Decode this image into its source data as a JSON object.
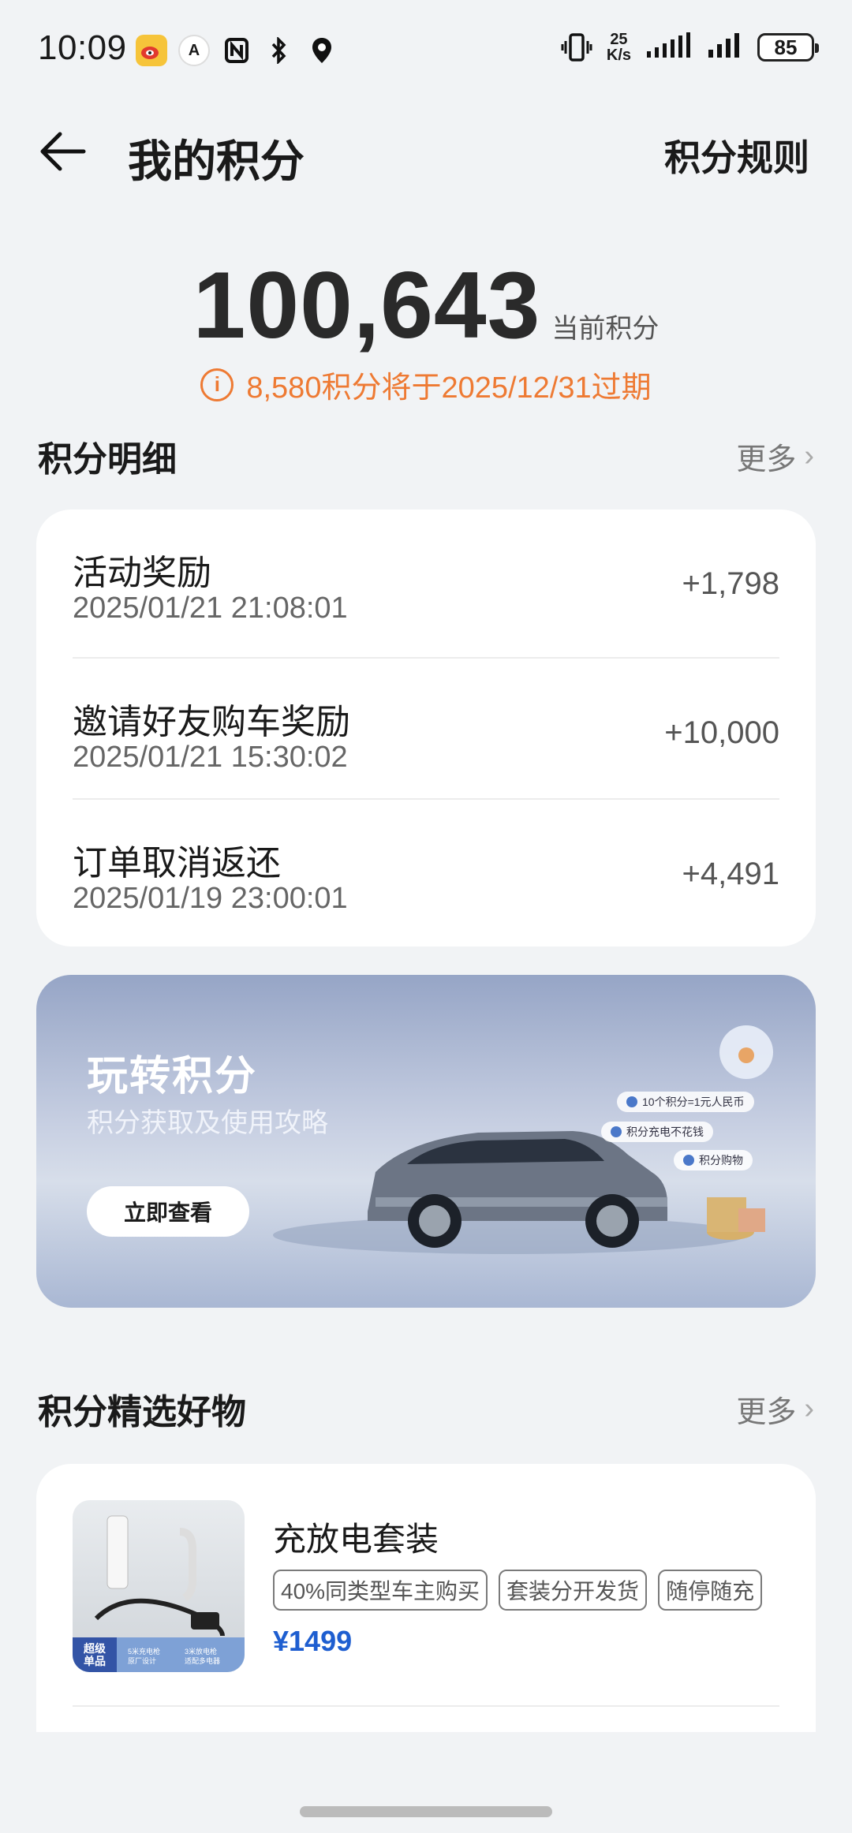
{
  "status_bar": {
    "time": "10:09",
    "net_speed_top": "25",
    "net_speed_bottom": "K/s",
    "battery": "85",
    "icons": [
      "weibo-icon",
      "app-a-icon",
      "nfc-icon",
      "bluetooth-icon",
      "location-icon",
      "vibrate-icon",
      "signal-icon",
      "signal-icon",
      "battery-icon"
    ]
  },
  "header": {
    "title": "我的积分",
    "rules_link": "积分规则"
  },
  "points": {
    "value": "100,643",
    "label": "当前积分",
    "expire_notice": "8,580积分将于2025/12/31过期",
    "info_glyph": "i",
    "accent_color": "#ee7a33"
  },
  "details_section": {
    "title": "积分明细",
    "more": "更多",
    "records": [
      {
        "title": "活动奖励",
        "time": "2025/01/21 21:08:01",
        "amount": "+1,798"
      },
      {
        "title": "邀请好友购车奖励",
        "time": "2025/01/21 15:30:02",
        "amount": "+10,000"
      },
      {
        "title": "订单取消返还",
        "time": "2025/01/19 23:00:01",
        "amount": "+4,491"
      }
    ]
  },
  "banner": {
    "title": "玩转积分",
    "subtitle": "积分获取及使用攻略",
    "button": "立即查看",
    "chips": [
      "10个积分=1元人民币",
      "积分充电不花钱",
      "积分购物"
    ]
  },
  "goods_section": {
    "title": "积分精选好物",
    "more": "更多",
    "products": [
      {
        "name": "充放电套装",
        "tags": [
          "40%同类型车主购买",
          "套装分开发货",
          "随停随充"
        ],
        "price": "¥1499",
        "thumb_badge_line1": "超级",
        "thumb_badge_line2": "单品",
        "thumb_text_a1": "5米充电枪",
        "thumb_text_a2": "原厂设计",
        "thumb_text_b1": "3米放电枪",
        "thumb_text_b2": "适配多电器"
      }
    ]
  },
  "colors": {
    "price_blue": "#1e5ed0",
    "background": "#f1f3f5"
  }
}
